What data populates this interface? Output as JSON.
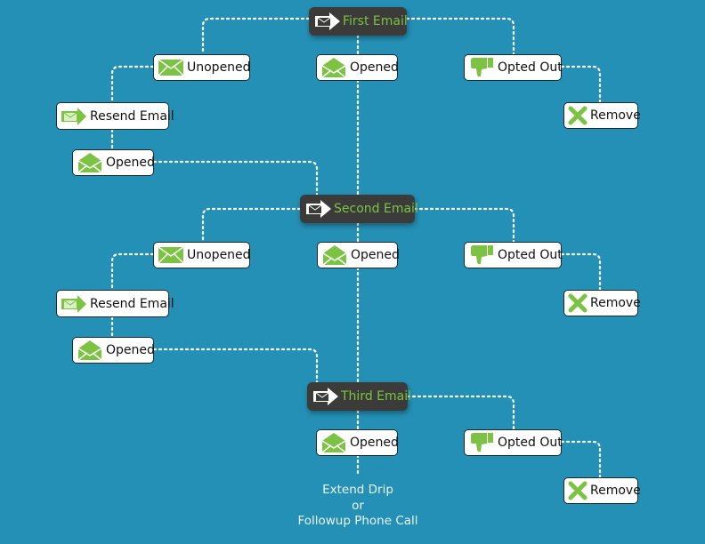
{
  "colors": {
    "background": "#2590b5",
    "accent_green": "#7cc243",
    "email_box": "#3b3b3a"
  },
  "stages": [
    {
      "email": {
        "label": "First Email",
        "icon": "send-email-icon"
      },
      "unopened": {
        "label": "Unopened",
        "icon": "closed-envelope-icon"
      },
      "opened": {
        "label": "Opened",
        "icon": "open-envelope-icon"
      },
      "opted_out": {
        "label": "Opted Out",
        "icon": "thumbs-down-icon"
      },
      "remove": {
        "label": "Remove",
        "icon": "x-icon"
      },
      "resend": {
        "label": "Resend Email",
        "icon": "resend-email-icon"
      },
      "resend_opened": {
        "label": "Opened",
        "icon": "open-envelope-icon"
      }
    },
    {
      "email": {
        "label": "Second Email",
        "icon": "send-email-icon"
      },
      "unopened": {
        "label": "Unopened",
        "icon": "closed-envelope-icon"
      },
      "opened": {
        "label": "Opened",
        "icon": "open-envelope-icon"
      },
      "opted_out": {
        "label": "Opted Out",
        "icon": "thumbs-down-icon"
      },
      "remove": {
        "label": "Remove",
        "icon": "x-icon"
      },
      "resend": {
        "label": "Resend Email",
        "icon": "resend-email-icon"
      },
      "resend_opened": {
        "label": "Opened",
        "icon": "open-envelope-icon"
      }
    },
    {
      "email": {
        "label": "Third Email",
        "icon": "send-email-icon"
      },
      "opened": {
        "label": "Opened",
        "icon": "open-envelope-icon"
      },
      "opted_out": {
        "label": "Opted Out",
        "icon": "thumbs-down-icon"
      },
      "remove": {
        "label": "Remove",
        "icon": "x-icon"
      }
    }
  ],
  "final_outcome": {
    "line1": "Extend Drip",
    "line2": "or",
    "line3": "Followup Phone Call"
  }
}
